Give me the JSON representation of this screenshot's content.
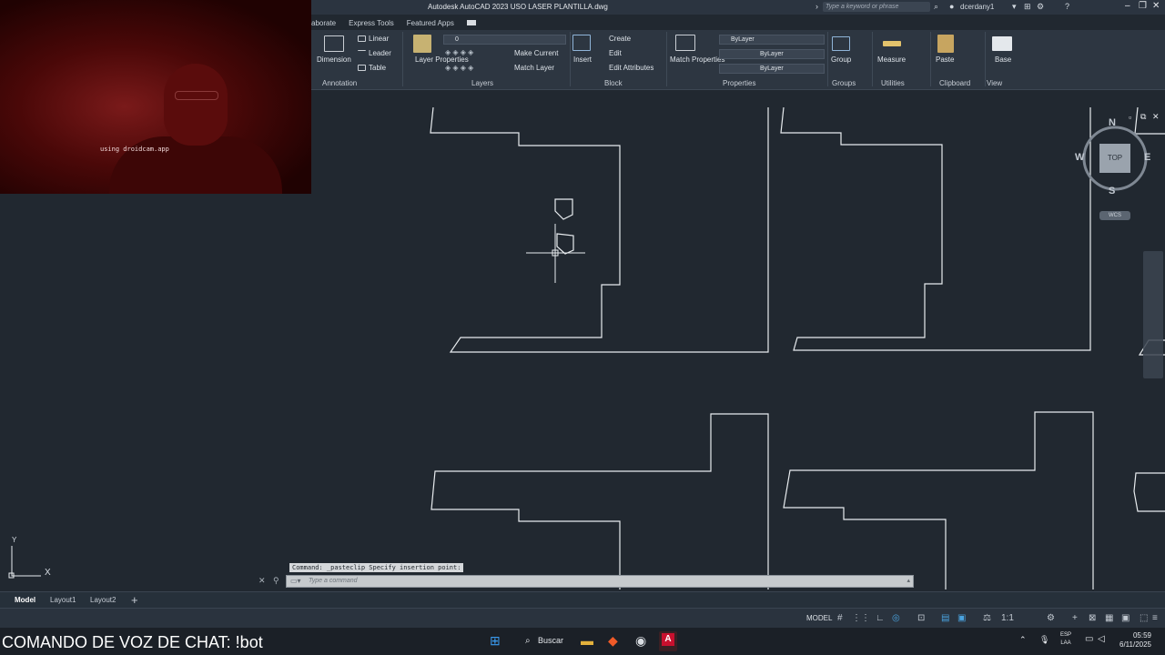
{
  "window": {
    "title": "Autodesk AutoCAD 2023     USO LASER PLANTILLA.dwg",
    "search_placeholder": "Type a keyword or phrase",
    "user": "dcerdany1"
  },
  "ribbon_tabs": [
    "aborate",
    "Express Tools",
    "Featured Apps"
  ],
  "ribbon": {
    "annotation": {
      "label": "Annotation",
      "dimension": "Dimension",
      "linear": "Linear",
      "leader": "Leader",
      "table": "Table"
    },
    "layers": {
      "label": "Layers",
      "layer_properties": "Layer Properties",
      "layer_value": "0",
      "make_current": "Make Current",
      "match_layer": "Match Layer"
    },
    "block": {
      "label": "Block",
      "insert": "Insert",
      "create": "Create",
      "edit": "Edit",
      "edit_attributes": "Edit Attributes"
    },
    "properties": {
      "label": "Properties",
      "match_properties": "Match Properties",
      "bylayer_1": "ByLayer",
      "bylayer_2": "ByLayer",
      "bylayer_3": "ByLayer"
    },
    "groups": {
      "label": "Groups",
      "group": "Group"
    },
    "utilities": {
      "label": "Utilities",
      "measure": "Measure"
    },
    "clipboard": {
      "label": "Clipboard",
      "paste": "Paste"
    },
    "view": {
      "label": "View",
      "base": "Base"
    }
  },
  "webcam": {
    "text": "using droidcam.app"
  },
  "viewcube": {
    "n": "N",
    "s": "S",
    "e": "E",
    "w": "W",
    "top": "TOP",
    "wcs": "WCS"
  },
  "ucs": {
    "y": "Y",
    "x": "X"
  },
  "command": {
    "history": "Command: _pasteclip Specify insertion point:",
    "placeholder": "Type a command"
  },
  "layout_tabs": [
    "Model",
    "Layout1",
    "Layout2"
  ],
  "status": {
    "model": "MODEL"
  },
  "overlay": {
    "text": "COMANDO DE VOZ DE CHAT: !bot"
  },
  "taskbar": {
    "search": "Buscar",
    "lang_1": "ESP",
    "lang_2": "LAA",
    "time": "05:59",
    "date": "6/11/2025"
  },
  "colors": {
    "background": "#212830",
    "accent": "#4aa3df",
    "autocad_red": "#c8102e"
  }
}
